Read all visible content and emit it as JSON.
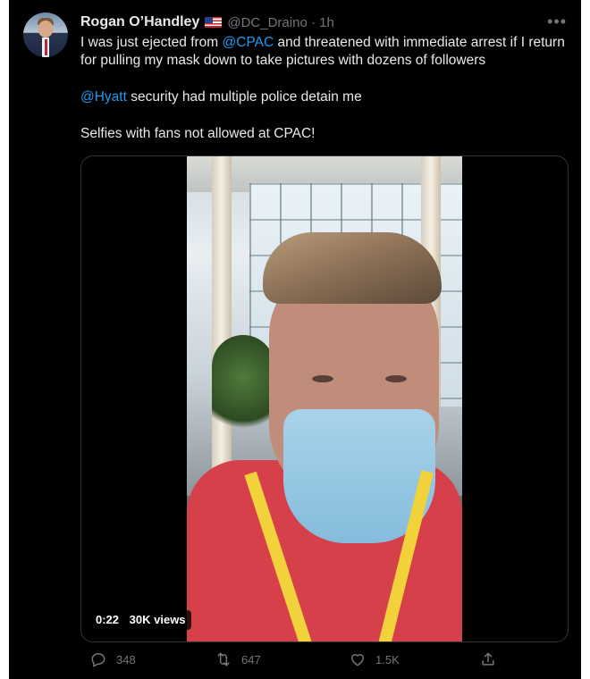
{
  "tweet": {
    "author_name": "Rogan O’Handley",
    "flag_icon": "us-flag-emoji",
    "handle": "@DC_Draino",
    "separator": " · ",
    "time": "1h",
    "more_icon": "more-horizontal-icon",
    "text": {
      "p1_a": "I was just ejected from ",
      "p1_mention": "@CPAC",
      "p1_b": " and threatened with immediate arrest if I return for pulling my mask down to take pictures with dozens of followers",
      "p2_mention": "@Hyatt",
      "p2_b": " security had multiple police detain me",
      "p3": "Selfies with fans not allowed at CPAC!"
    },
    "video": {
      "duration": "0:22",
      "views": "30K views"
    },
    "actions": {
      "replies": "348",
      "retweets": "647",
      "likes": "1.5K"
    }
  },
  "colors": {
    "background": "#000000",
    "text": "#e7e9ea",
    "muted": "#71767b",
    "link": "#1d9bf0"
  }
}
